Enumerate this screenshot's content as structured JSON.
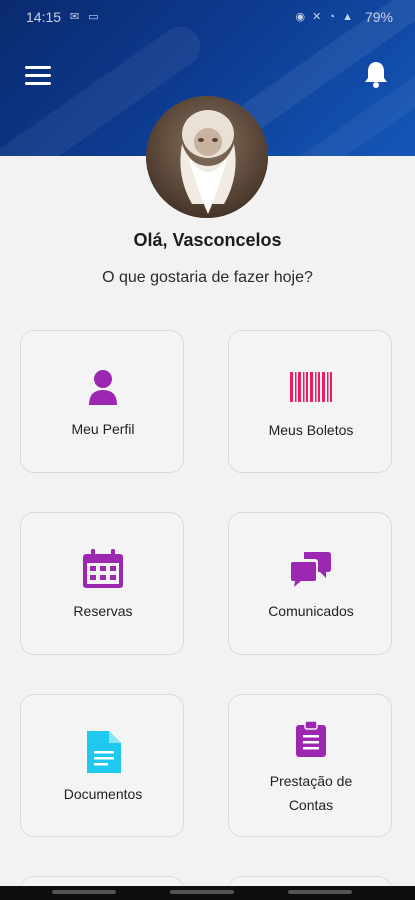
{
  "status_bar": {
    "time": "14:15",
    "battery": "79%"
  },
  "header": {
    "menu_icon": "hamburger-menu-icon",
    "notification_icon": "bell-icon"
  },
  "user": {
    "greeting": "Olá, Vasconcelos",
    "question": "O que gostaria de fazer hoje?"
  },
  "menu_cards": [
    {
      "label": "Meu Perfil",
      "icon": "user-icon",
      "color": "#9c27b0"
    },
    {
      "label": "Meus Boletos",
      "icon": "barcode-icon",
      "color": "#e91e63"
    },
    {
      "label": "Reservas",
      "icon": "calendar-icon",
      "color": "#9c27b0"
    },
    {
      "label": "Comunicados",
      "icon": "chat-bubbles-icon",
      "color": "#9c27b0"
    },
    {
      "label": "Documentos",
      "icon": "document-icon",
      "color": "#1ec8ee"
    },
    {
      "label": "Prestação de Contas",
      "icon": "clipboard-icon",
      "color": "#9c27b0"
    }
  ],
  "colors": {
    "header_dark": "#0a2a6e",
    "header_light": "#1457b8",
    "accent_purple": "#9c27b0",
    "accent_pink": "#e91e63",
    "accent_cyan": "#1ec8ee"
  }
}
